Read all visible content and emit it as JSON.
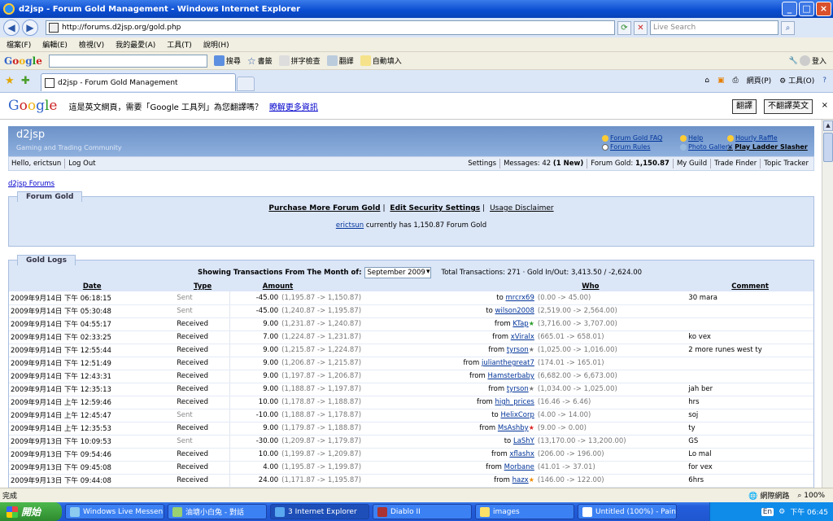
{
  "window": {
    "title": "d2jsp - Forum Gold Management - Windows Internet Explorer"
  },
  "address": {
    "url": "http://forums.d2jsp.org/gold.php",
    "search_placeholder": "Live Search"
  },
  "menu": [
    "檔案(F)",
    "編輯(E)",
    "檢視(V)",
    "我的最愛(A)",
    "工具(T)",
    "說明(H)"
  ],
  "google_toolbar": {
    "logo": "Google",
    "search": "搜尋",
    "bookmarks": "書籤",
    "spellcheck": "拼字檢查",
    "translate": "翻譯",
    "autofill": "自動填入",
    "login": "登入"
  },
  "tab": {
    "title": "d2jsp - Forum Gold Management"
  },
  "commands": {
    "page": "網頁(P)",
    "tools": "工具(O)"
  },
  "translate_bar": {
    "logo": "Google",
    "message": "這是英文網頁，需要「Google 工具列」為您翻譯嗎？",
    "learn_more": "瞭解更多資訊",
    "translate_btn": "翻譯",
    "no_translate_btn": "不翻譯英文"
  },
  "site": {
    "brand": "d2jsp",
    "tagline": "Gaming and Trading Community",
    "links": {
      "gold_faq": "Forum Gold FAQ",
      "rules": "Forum Rules",
      "help": "Help",
      "gallery": "Photo Gallery",
      "raffle": "Hourly Raffle",
      "ladder": "Play Ladder Slasher"
    },
    "subnav": {
      "hello": "Hello, erictsun",
      "logout": "Log Out",
      "settings": "Settings",
      "messages": "Messages: 42",
      "messages_new": "(1 New)",
      "forum_gold": "Forum Gold:",
      "forum_gold_value": "1,150.87",
      "guild": "My Guild",
      "trade": "Trade Finder",
      "topic": "Topic Tracker"
    },
    "breadcrumb": "d2jsp Forums"
  },
  "forum_gold": {
    "tab": "Forum Gold",
    "purchase": "Purchase More Forum Gold",
    "security": "Edit Security Settings",
    "disclaimer": "Usage Disclaimer",
    "user": "erictsun",
    "has_text": "currently has 1,150.87 Forum Gold"
  },
  "gold_logs": {
    "tab": "Gold Logs",
    "showing": "Showing Transactions From The Month of:",
    "month": "September 2009",
    "totals": "Total Transactions: 271 · Gold In/Out: 3,413.50 / -2,624.00",
    "columns": {
      "date": "Date",
      "type": "Type",
      "amount": "Amount",
      "who": "Who",
      "comment": "Comment"
    },
    "rows": [
      {
        "date": "2009年9月14日 下午 06:18:15",
        "type": "Sent",
        "amount": "-45.00",
        "range": "(1,195.87 -> 1,150.87)",
        "dir": "to",
        "user": "mrcrx69",
        "star": "",
        "urange": "(0.00 -> 45.00)",
        "comment": "30 mara"
      },
      {
        "date": "2009年9月14日 下午 05:30:48",
        "type": "Sent",
        "amount": "-45.00",
        "range": "(1,240.87 -> 1,195.87)",
        "dir": "to",
        "user": "wilson2008",
        "star": "",
        "urange": "(2,519.00 -> 2,564.00)",
        "comment": ""
      },
      {
        "date": "2009年9月14日 下午 04:55:17",
        "type": "Received",
        "amount": "9.00",
        "range": "(1,231.87 -> 1,240.87)",
        "dir": "from",
        "user": "KTap",
        "star": "green",
        "urange": "(3,716.00 -> 3,707.00)",
        "comment": ""
      },
      {
        "date": "2009年9月14日 下午 02:33:25",
        "type": "Received",
        "amount": "7.00",
        "range": "(1,224.87 -> 1,231.87)",
        "dir": "from",
        "user": "xViralx",
        "star": "",
        "urange": "(665.01 -> 658.01)",
        "comment": "ko vex"
      },
      {
        "date": "2009年9月14日 下午 12:55:44",
        "type": "Received",
        "amount": "9.00",
        "range": "(1,215.87 -> 1,224.87)",
        "dir": "from",
        "user": "tyrson",
        "star": "gray",
        "urange": "(1,025.00 -> 1,016.00)",
        "comment": "2 more runes west ty"
      },
      {
        "date": "2009年9月14日 下午 12:51:49",
        "type": "Received",
        "amount": "9.00",
        "range": "(1,206.87 -> 1,215.87)",
        "dir": "from",
        "user": "julianthegreat7",
        "star": "",
        "urange": "(174.01 -> 165.01)",
        "comment": ""
      },
      {
        "date": "2009年9月14日 下午 12:43:31",
        "type": "Received",
        "amount": "9.00",
        "range": "(1,197.87 -> 1,206.87)",
        "dir": "from",
        "user": "Hamsterbaby",
        "star": "",
        "urange": "(6,682.00 -> 6,673.00)",
        "comment": ""
      },
      {
        "date": "2009年9月14日 下午 12:35:13",
        "type": "Received",
        "amount": "9.00",
        "range": "(1,188.87 -> 1,197.87)",
        "dir": "from",
        "user": "tyrson",
        "star": "gray",
        "urange": "(1,034.00 -> 1,025.00)",
        "comment": "jah ber"
      },
      {
        "date": "2009年9月14日 上午 12:59:46",
        "type": "Received",
        "amount": "10.00",
        "range": "(1,178.87 -> 1,188.87)",
        "dir": "from",
        "user": "high_prices",
        "star": "",
        "urange": "(16.46 -> 6.46)",
        "comment": "hrs"
      },
      {
        "date": "2009年9月14日 上午 12:45:47",
        "type": "Sent",
        "amount": "-10.00",
        "range": "(1,188.87 -> 1,178.87)",
        "dir": "to",
        "user": "HelixCorp",
        "star": "",
        "urange": "(4.00 -> 14.00)",
        "comment": "soj"
      },
      {
        "date": "2009年9月14日 上午 12:35:53",
        "type": "Received",
        "amount": "9.00",
        "range": "(1,179.87 -> 1,188.87)",
        "dir": "from",
        "user": "MsAshby",
        "star": "red",
        "urange": "(9.00 -> 0.00)",
        "comment": "ty"
      },
      {
        "date": "2009年9月13日 下午 10:09:53",
        "type": "Sent",
        "amount": "-30.00",
        "range": "(1,209.87 -> 1,179.87)",
        "dir": "to",
        "user": "LaShY",
        "star": "",
        "urange": "(13,170.00 -> 13,200.00)",
        "comment": "GS"
      },
      {
        "date": "2009年9月13日 下午 09:54:46",
        "type": "Received",
        "amount": "10.00",
        "range": "(1,199.87 -> 1,209.87)",
        "dir": "from",
        "user": "xflashx",
        "star": "",
        "urange": "(206.00 -> 196.00)",
        "comment": "Lo mal"
      },
      {
        "date": "2009年9月13日 下午 09:45:08",
        "type": "Received",
        "amount": "4.00",
        "range": "(1,195.87 -> 1,199.87)",
        "dir": "from",
        "user": "Morbane",
        "star": "",
        "urange": "(41.01 -> 37.01)",
        "comment": "for vex"
      },
      {
        "date": "2009年9月13日 下午 09:44:08",
        "type": "Received",
        "amount": "24.00",
        "range": "(1,171.87 -> 1,195.87)",
        "dir": "from",
        "user": "hazx",
        "star": "orange",
        "urange": "(146.00 -> 122.00)",
        "comment": "6hrs"
      }
    ]
  },
  "status": {
    "left": "完成",
    "zone": "網際網路",
    "zoom": "100%"
  },
  "taskbar": {
    "start": "開始",
    "tasks": [
      "Windows Live Messen...",
      "油塘小白兔 - 對話",
      "3 Internet Explorer",
      "Diablo II",
      "images",
      "Untitled (100%) - Pain..."
    ],
    "clock": "下午 06:45",
    "lang": "En"
  }
}
